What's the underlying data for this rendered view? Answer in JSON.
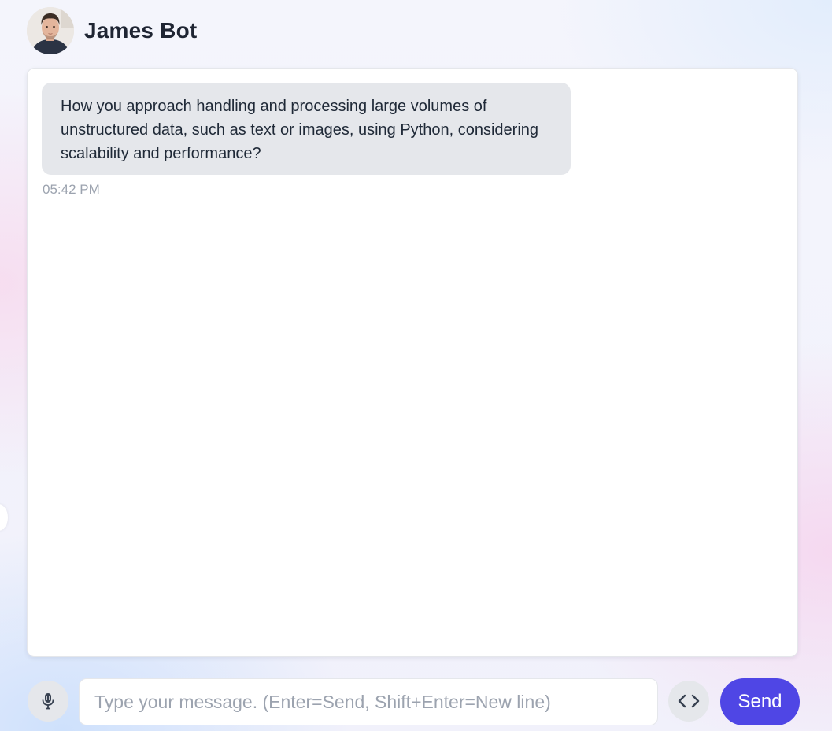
{
  "header": {
    "bot_name": "James Bot",
    "avatar_icon": "user-avatar-photo"
  },
  "chat": {
    "messages": [
      {
        "text": "How you approach handling and processing large volumes of unstructured data, such as text or images, using Python, considering scalability and performance?",
        "time": "05:42 PM"
      }
    ]
  },
  "input_bar": {
    "mic_icon": "microphone-icon",
    "placeholder": "Type your message. (Enter=Send, Shift+Enter=New line)",
    "value": "",
    "code_icon": "code-brackets-icon",
    "send_label": "Send"
  },
  "colors": {
    "accent": "#4f46e5",
    "bubble": "#e5e7eb",
    "timestamp": "#9ca3af",
    "text": "#1f2937"
  }
}
